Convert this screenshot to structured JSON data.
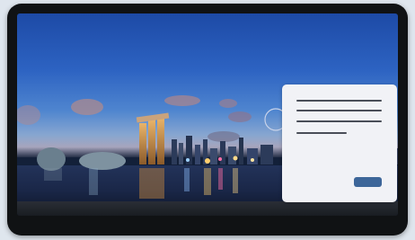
{
  "scene": {
    "subject": "city-skyline-wallpaper"
  },
  "dialog": {
    "text_lines": [
      "",
      "",
      "",
      ""
    ],
    "button_label": ""
  },
  "colors": {
    "device_bezel": "#101214",
    "dialog_background": "#f1f2f6",
    "dialog_text_line": "#4a4e58",
    "dialog_button": "#3d6699",
    "taskbar": "#1a1d22"
  }
}
